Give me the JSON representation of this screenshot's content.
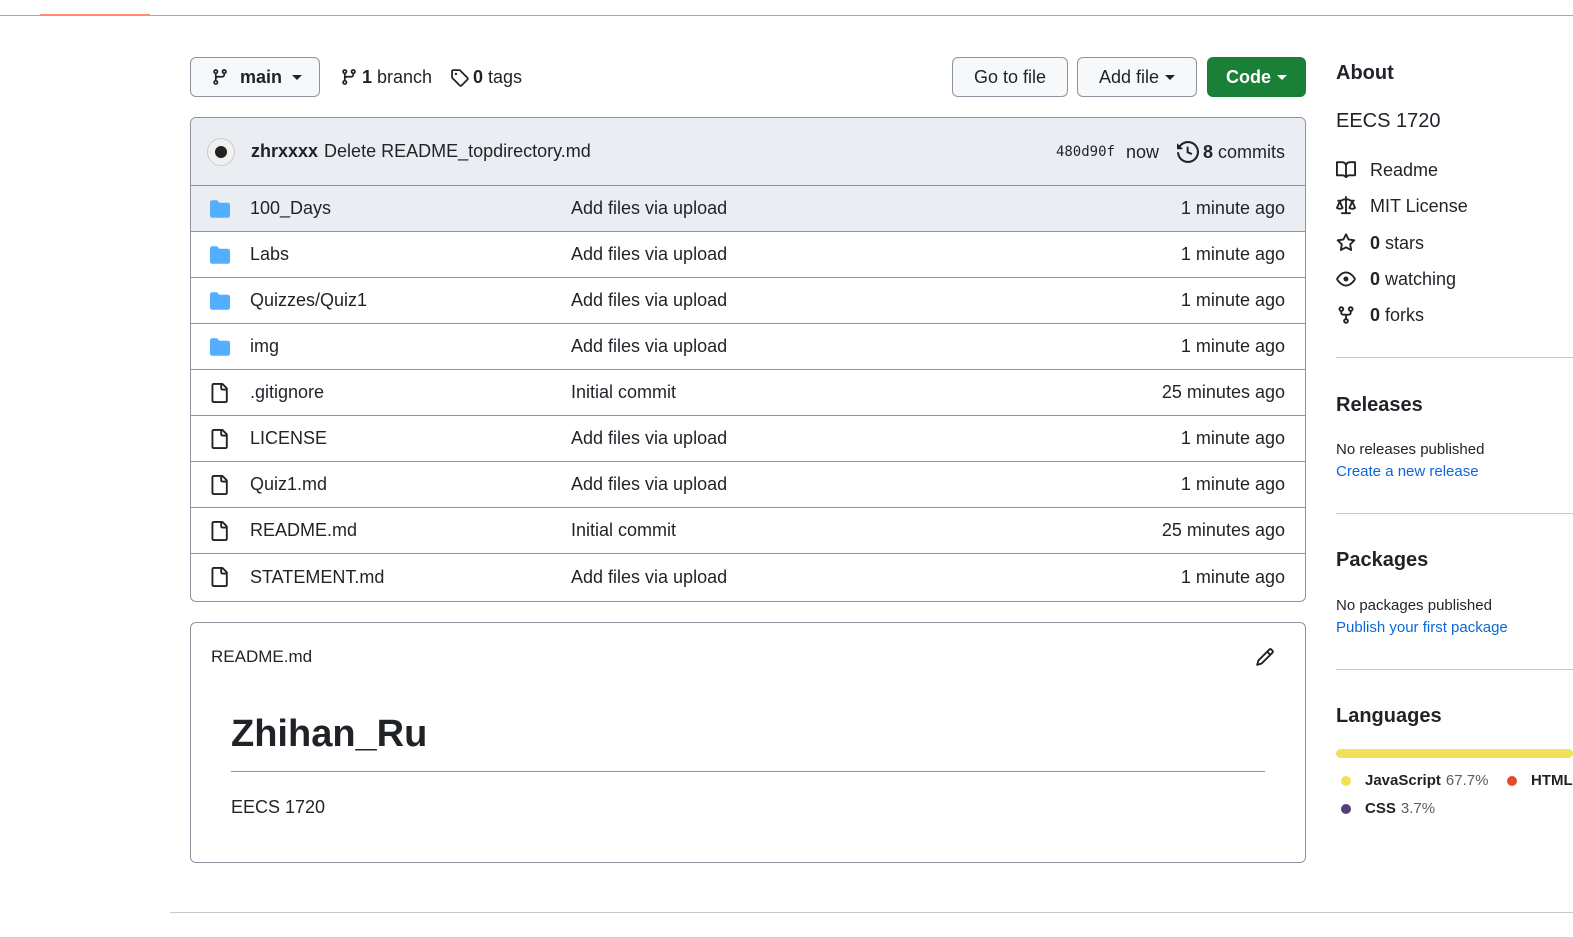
{
  "toolbar": {
    "branch_name": "main",
    "branch_count": "1",
    "branch_label": "branch",
    "tag_count": "0",
    "tag_label": "tags",
    "go_to_file": "Go to file",
    "add_file": "Add file",
    "code": "Code"
  },
  "latest_commit": {
    "author": "zhrxxxx",
    "message": "Delete README_topdirectory.md",
    "sha": "480d90f",
    "when": "now",
    "commit_count": "8",
    "commit_label": "commits"
  },
  "files": [
    {
      "type": "folder",
      "name": "100_Days",
      "message": "Add files via upload",
      "time": "1 minute ago"
    },
    {
      "type": "folder",
      "name": "Labs",
      "message": "Add files via upload",
      "time": "1 minute ago"
    },
    {
      "type": "folder",
      "name": "Quizzes/Quiz1",
      "message": "Add files via upload",
      "time": "1 minute ago"
    },
    {
      "type": "folder",
      "name": "img",
      "message": "Add files via upload",
      "time": "1 minute ago"
    },
    {
      "type": "file",
      "name": ".gitignore",
      "message": "Initial commit",
      "time": "25 minutes ago"
    },
    {
      "type": "file",
      "name": "LICENSE",
      "message": "Add files via upload",
      "time": "1 minute ago"
    },
    {
      "type": "file",
      "name": "Quiz1.md",
      "message": "Add files via upload",
      "time": "1 minute ago"
    },
    {
      "type": "file",
      "name": "README.md",
      "message": "Initial commit",
      "time": "25 minutes ago"
    },
    {
      "type": "file",
      "name": "STATEMENT.md",
      "message": "Add files via upload",
      "time": "1 minute ago"
    }
  ],
  "readme": {
    "filename": "README.md",
    "heading": "Zhihan_Ru",
    "body": "EECS 1720"
  },
  "about": {
    "title": "About",
    "description": "EECS 1720",
    "readme": "Readme",
    "license": "MIT License",
    "stars_count": "0",
    "stars_label": "stars",
    "watching_count": "0",
    "watching_label": "watching",
    "forks_count": "0",
    "forks_label": "forks"
  },
  "releases": {
    "title": "Releases",
    "none": "No releases published",
    "link": "Create a new release"
  },
  "packages": {
    "title": "Packages",
    "none": "No packages published",
    "link": "Publish your first package"
  },
  "languages": {
    "title": "Languages",
    "items": [
      {
        "name": "JavaScript",
        "percent": "67.7%",
        "color": "#f1e05a"
      },
      {
        "name": "HTML",
        "percent": "",
        "color": "#e34c26"
      },
      {
        "name": "CSS",
        "percent": "3.7%",
        "color": "#563d7c"
      }
    ]
  },
  "colors": {
    "primary_button": "#1a7f37",
    "folder_icon": "#54aeff",
    "link": "#0969da"
  }
}
